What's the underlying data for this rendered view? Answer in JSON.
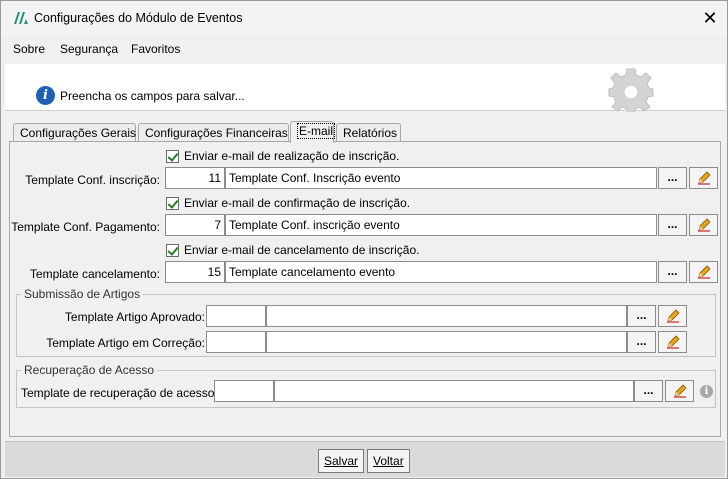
{
  "window": {
    "title": "Configurações do Módulo de Eventos",
    "close_glyph": "✕"
  },
  "menu": {
    "items": [
      "Sobre",
      "Segurança",
      "Favoritos"
    ]
  },
  "info": {
    "icon_glyph": "i",
    "message": "Preencha os campos para salvar..."
  },
  "tabs": [
    "Configurações Gerais",
    "Configurações Financeiras",
    "E-mail",
    "Relatórios"
  ],
  "active_tab": "E-mail",
  "email": {
    "rows": [
      {
        "checkbox_label": "Enviar e-mail de realização de inscrição.",
        "checked": true,
        "label": "Template Conf. inscrição:",
        "code": "11",
        "description": "Template Conf. Inscrição evento"
      },
      {
        "checkbox_label": "Enviar e-mail de confirmação de inscrição.",
        "checked": true,
        "label": "Template Conf. Pagamento:",
        "code": "7",
        "description": "Template Conf. inscrição evento"
      },
      {
        "checkbox_label": "Enviar e-mail de cancelamento de inscrição.",
        "checked": true,
        "label": "Template cancelamento:",
        "code": "15",
        "description": "Template cancelamento evento"
      }
    ],
    "dots_label": "...",
    "submissao": {
      "title": "Submissão de Artigos",
      "rows": [
        {
          "label": "Template Artigo Aprovado:",
          "code": "",
          "description": ""
        },
        {
          "label": "Template Artigo em Correção:",
          "code": "",
          "description": ""
        }
      ]
    },
    "recuperacao": {
      "title": "Recuperação de Acesso",
      "label": "Template de recuperação de acesso:",
      "code": "",
      "description": "",
      "help_glyph": "i"
    }
  },
  "footer": {
    "save_label": "Salvar",
    "back_label": "Voltar"
  },
  "colors": {
    "info_icon": "#1f5fb8",
    "check": "#2a7a2a",
    "pencil": "#e8a317"
  }
}
